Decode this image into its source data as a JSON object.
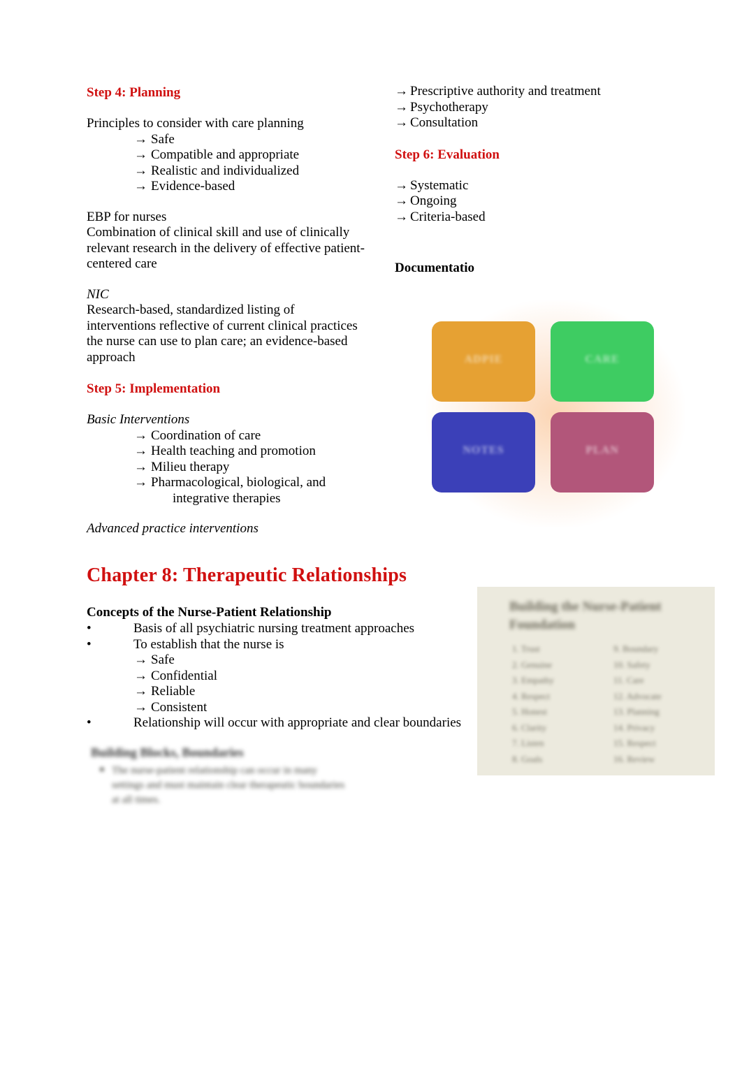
{
  "left_column": {
    "step4_heading": "Step 4: Planning",
    "planning_intro": "Principles to consider with care planning",
    "planning_items": [
      "Safe",
      "Compatible and appropriate",
      "Realistic and individualized",
      "Evidence-based"
    ],
    "ebp_title": "EBP for nurses",
    "ebp_body": "Combination of clinical skill and use of clinically relevant research in the delivery of effective patient-centered care",
    "nic_title": "NIC",
    "nic_body": "Research-based, standardized listing of interventions reflective of current clinical practices the nurse can use to plan care; an evidence-based approach",
    "step5_heading": "Step 5: Implementation",
    "basic_interventions_title": "Basic Interventions",
    "basic_interventions": [
      "Coordination of care",
      "Health teaching and promotion",
      "Milieu therapy",
      "Pharmacological, biological, and"
    ],
    "basic_interventions_continued": "integrative therapies",
    "advanced_practice": "Advanced practice interventions"
  },
  "right_column": {
    "advanced_items": [
      "Prescriptive authority and treatment",
      "Psychotherapy",
      "Consultation"
    ],
    "step6_heading": "Step 6: Evaluation",
    "evaluation_items": [
      "Systematic",
      "Ongoing",
      "Criteria-based"
    ],
    "documentation_heading": "Documentatio"
  },
  "chapter": {
    "title": "Chapter 8: Therapeutic Relationships",
    "section_heading": "Concepts of the Nurse-Patient Relationship",
    "bullets": [
      "Basis of all psychiatric nursing treatment approaches",
      "To establish that the nurse is"
    ],
    "sub_items": [
      "Safe",
      "Confidential",
      "Reliable",
      "Consistent"
    ],
    "final_bullet": "Relationship will occur with appropriate and clear boundaries",
    "bullet_char": "•"
  },
  "graphics": {
    "quad_figure": {
      "name": "four-quadrant-diagram",
      "quadrants": [
        {
          "label": "ADPIE",
          "color": "#e6a133"
        },
        {
          "label": "CARE",
          "color": "#3ecc62"
        },
        {
          "label": "NOTES",
          "color": "#3b40b8"
        },
        {
          "label": "PLAN",
          "color": "#b2567a"
        }
      ]
    },
    "nurse_patient_image": {
      "title": "Building the Nurse-Patient Foundation",
      "column_one": [
        "1. Trust",
        "2. Genuine",
        "3. Empathy",
        "4. Respect",
        "5. Honest",
        "6. Clarity",
        "7. Listen",
        "8. Goals"
      ],
      "column_two": [
        "9. Boundary",
        "10. Safety",
        "11. Care",
        "12. Advocate",
        "13. Planning",
        "14. Privacy",
        "15. Respect",
        "16. Review"
      ]
    },
    "blurred_note_image": {
      "title": "Building Blocks, Boundaries",
      "body": "The nurse-patient relationship can occur in many settings and must maintain clear therapeutic boundaries at all times."
    }
  }
}
